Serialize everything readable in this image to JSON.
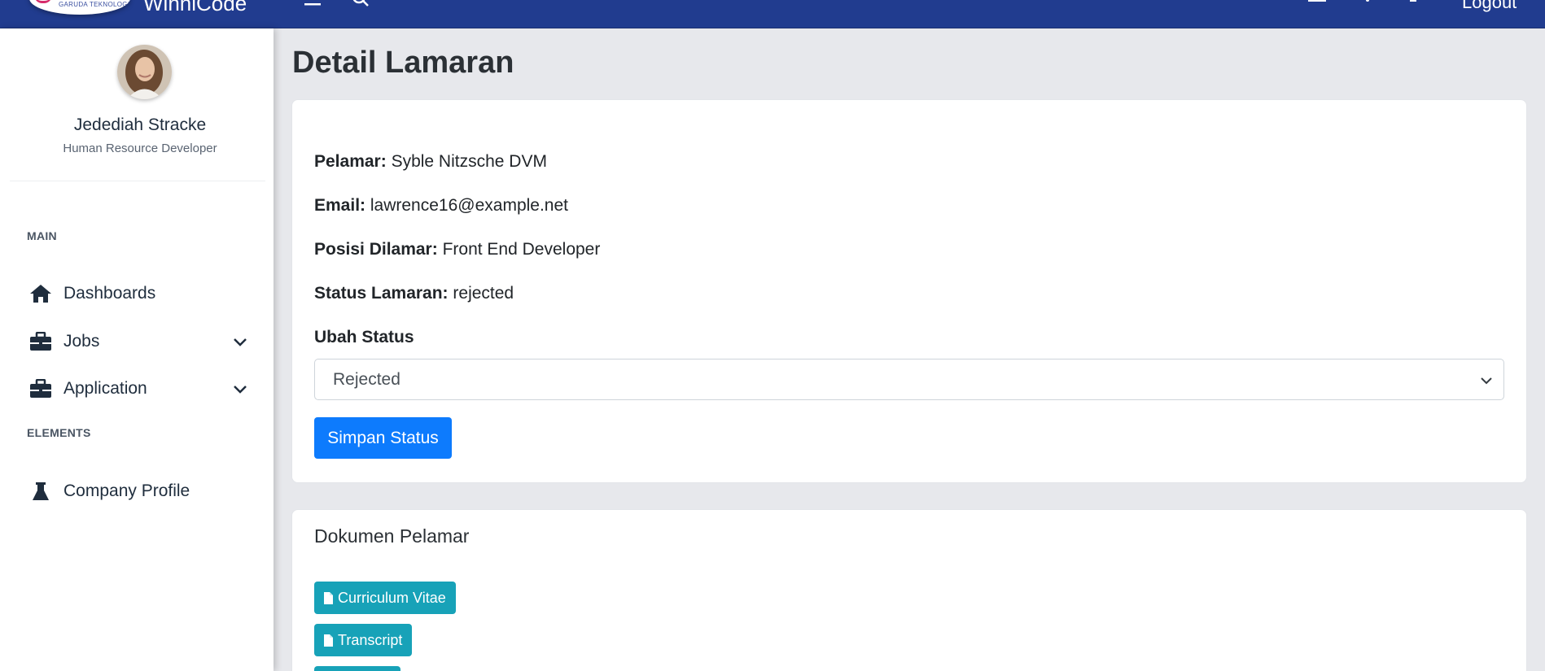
{
  "header": {
    "brand_name": "WinniCode",
    "logo_text": "GARUDA TEKNOLOGI",
    "logout_label": "Logout",
    "color": "#213c8f"
  },
  "sidebar": {
    "user": {
      "name": "Jedediah Stracke",
      "role": "Human Resource Developer"
    },
    "sections": [
      {
        "label": "MAIN",
        "items": [
          {
            "label": "Dashboards",
            "icon": "home-icon"
          },
          {
            "label": "Jobs",
            "icon": "briefcase-icon",
            "expandable": true
          },
          {
            "label": "Application",
            "icon": "briefcase-icon",
            "expandable": true
          }
        ]
      },
      {
        "label": "ELEMENTS",
        "items": [
          {
            "label": "Company Profile",
            "icon": "flask-icon"
          }
        ]
      }
    ]
  },
  "main": {
    "page_title": "Detail Lamaran",
    "details": {
      "applicant_label": "Pelamar:",
      "applicant_value": "Syble Nitzsche DVM",
      "email_label": "Email:",
      "email_value": "lawrence16@example.net",
      "position_label": "Posisi Dilamar:",
      "position_value": "Front End Developer",
      "status_label": "Status Lamaran:",
      "status_value": "rejected"
    },
    "change_status": {
      "label": "Ubah Status",
      "selected": "Rejected",
      "save_label": "Simpan Status",
      "button_color": "#0d7bfd"
    },
    "documents": {
      "title": "Dokumen Pelamar",
      "items": [
        "Curriculum Vitae",
        "Transcript"
      ],
      "button_color": "#17a2b8"
    }
  }
}
